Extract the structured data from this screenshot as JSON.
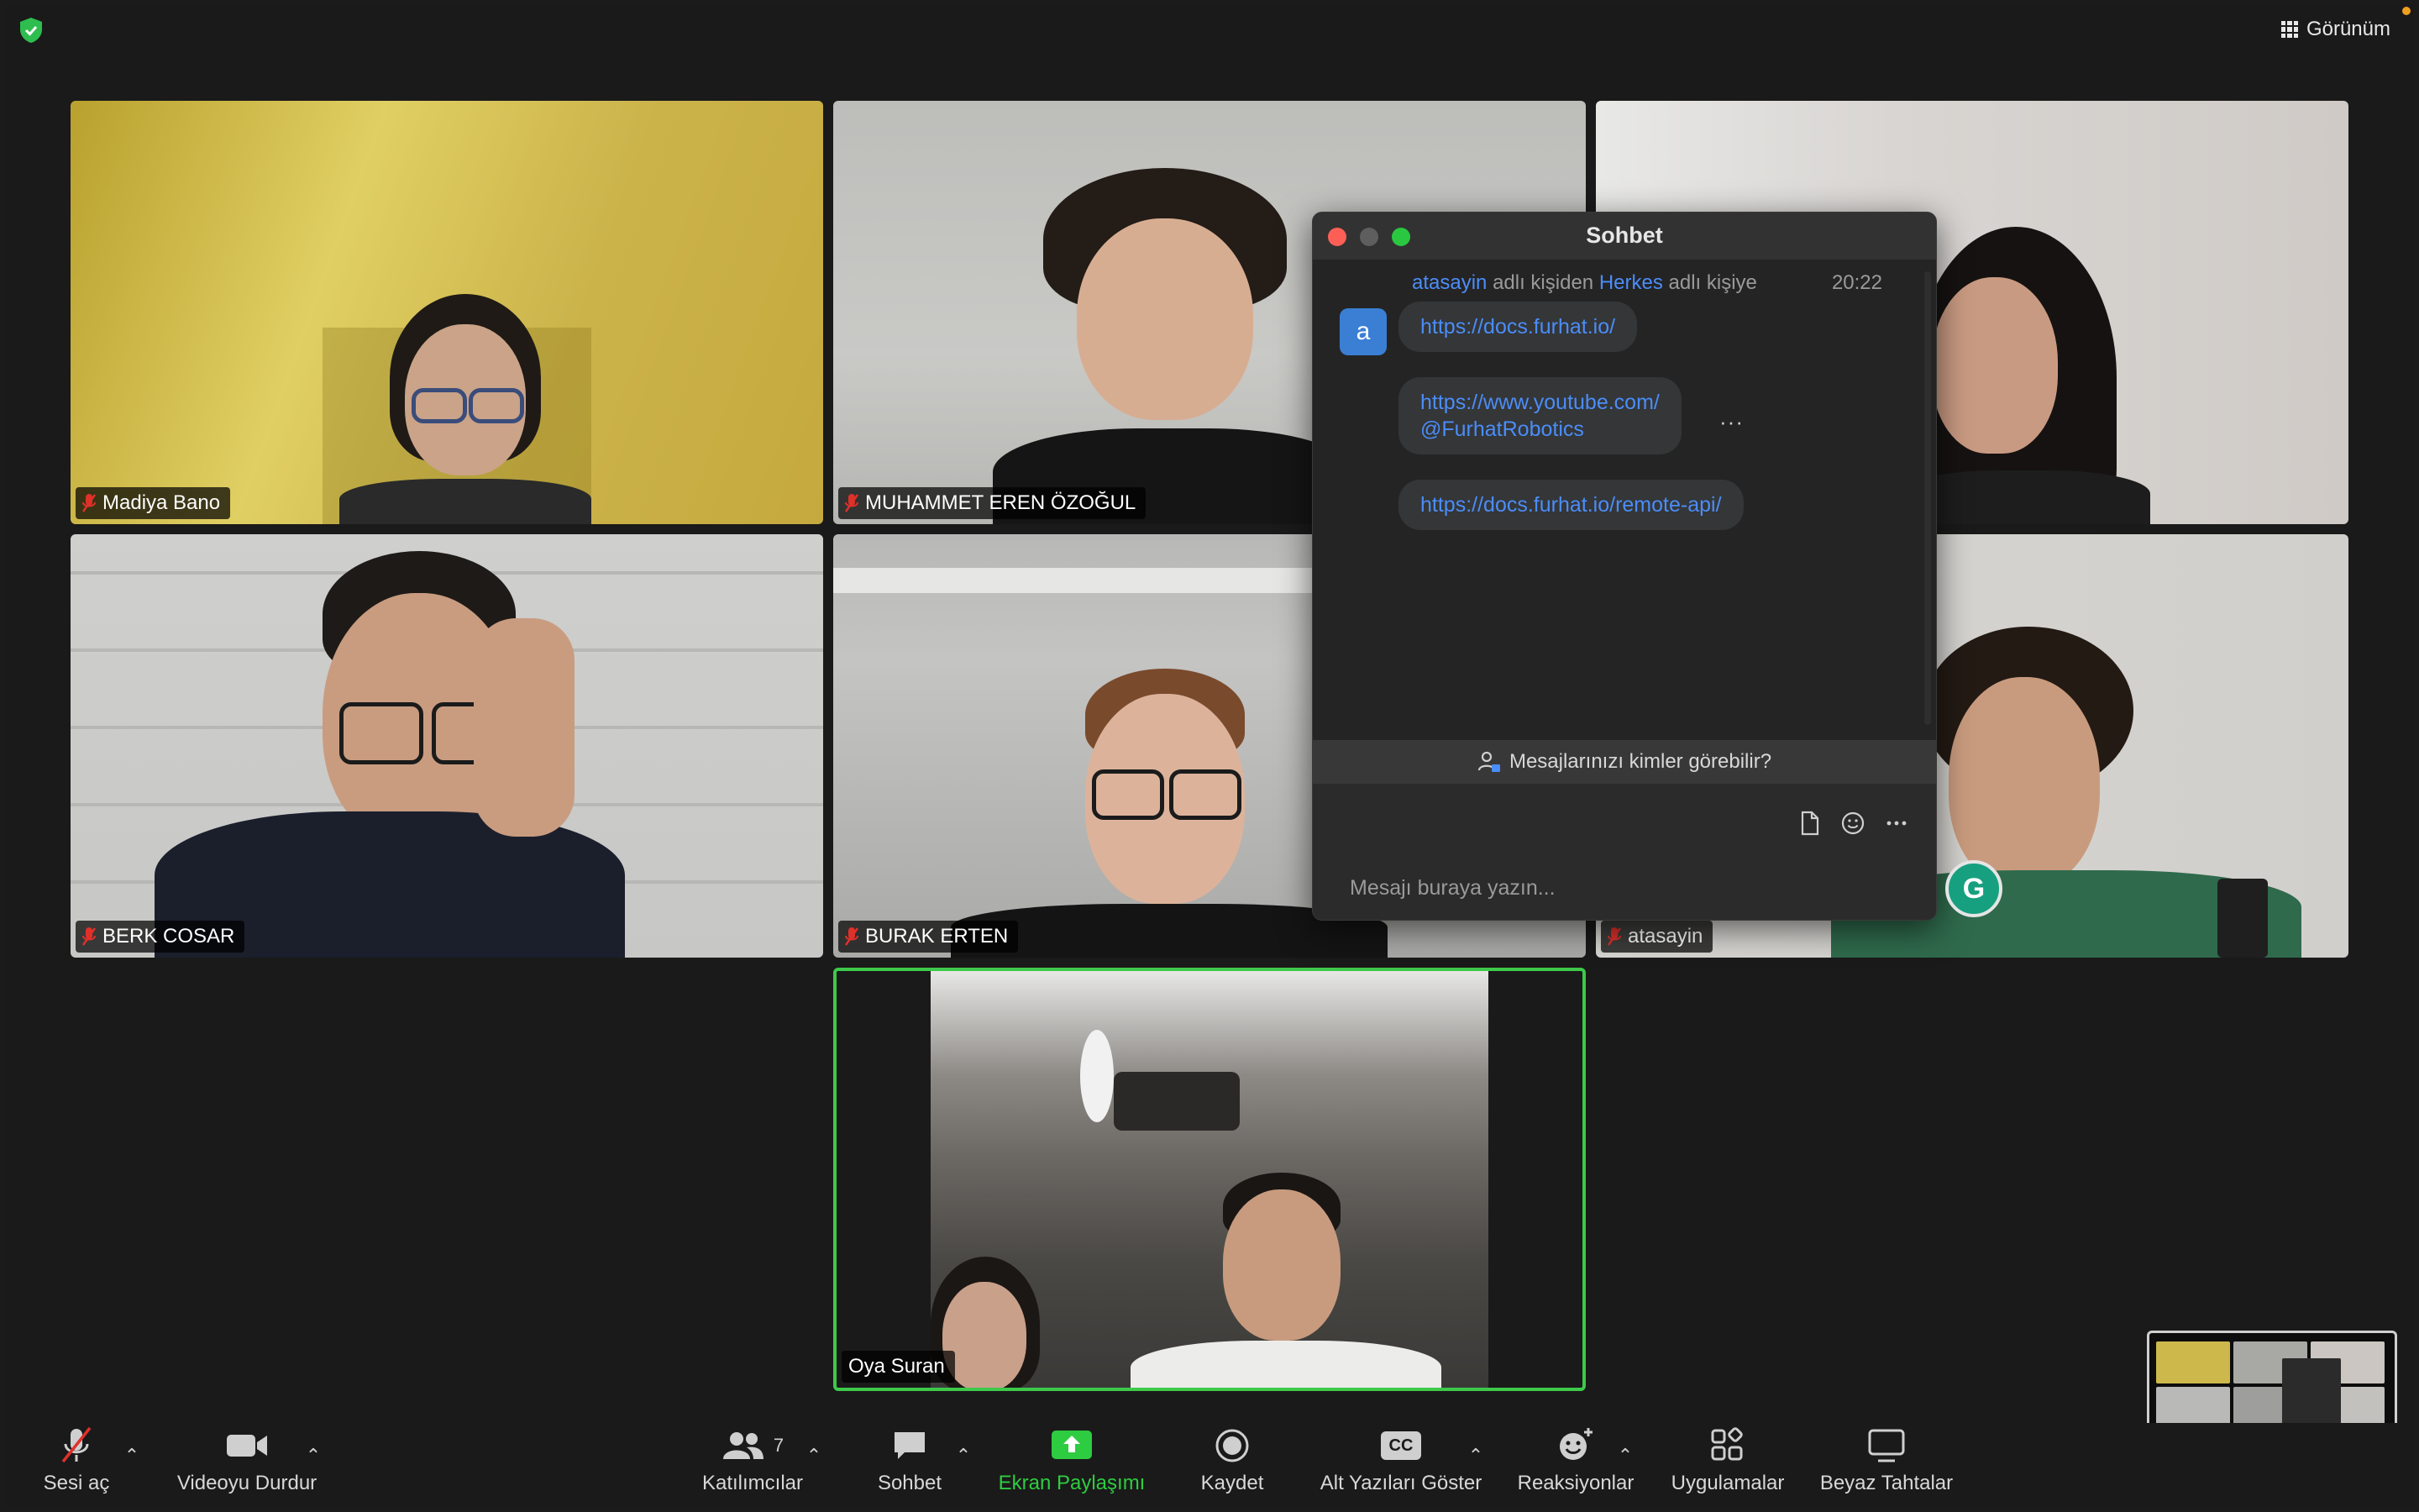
{
  "header": {
    "view_label": "Görünüm",
    "security_icon": "shield-check-icon"
  },
  "participants": [
    {
      "name": "Madiya Bano",
      "muted": true
    },
    {
      "name": "MUHAMMET EREN ÖZOĞUL",
      "muted": true
    },
    {
      "name": "BERK COSAR",
      "muted": true
    },
    {
      "name": "BURAK ERTEN",
      "muted": true
    },
    {
      "name": "atasayin",
      "muted": true
    },
    {
      "name": "Oya Suran",
      "muted": false,
      "active_speaker": true
    }
  ],
  "chat": {
    "title": "Sohbet",
    "sender": "atasayin",
    "header_mid": "adlı kişiden",
    "recipient": "Herkes",
    "header_end": "adlı kişiye",
    "time": "20:22",
    "avatar_letter": "a",
    "messages": [
      {
        "text": "https://docs.furhat.io/"
      },
      {
        "line1": "https://www.youtube.com/",
        "line2": "@FurhatRobotics"
      },
      {
        "text": "https://docs.furhat.io/remote-api/"
      }
    ],
    "more_label": "···",
    "privacy_text": "Mesajlarınızı kimler görebilir?",
    "input_placeholder": "Mesajı buraya yazın..."
  },
  "toolbar": {
    "unmute": "Sesi aç",
    "stop_video": "Videoyu Durdur",
    "participants": "Katılımcılar",
    "participants_count": "7",
    "chat": "Sohbet",
    "share_screen": "Ekran Paylaşımı",
    "record": "Kaydet",
    "captions": "Alt Yazıları Göster",
    "captions_badge": "CC",
    "reactions": "Reaksiyonlar",
    "apps": "Uygulamalar",
    "whiteboards": "Beyaz Tahtalar"
  },
  "grammarly_letter": "G",
  "colors": {
    "accent_blue": "#4b8df8",
    "share_green": "#2ecc40",
    "active_speaker_border": "#3ec94a",
    "muted_red": "#e0302a"
  }
}
